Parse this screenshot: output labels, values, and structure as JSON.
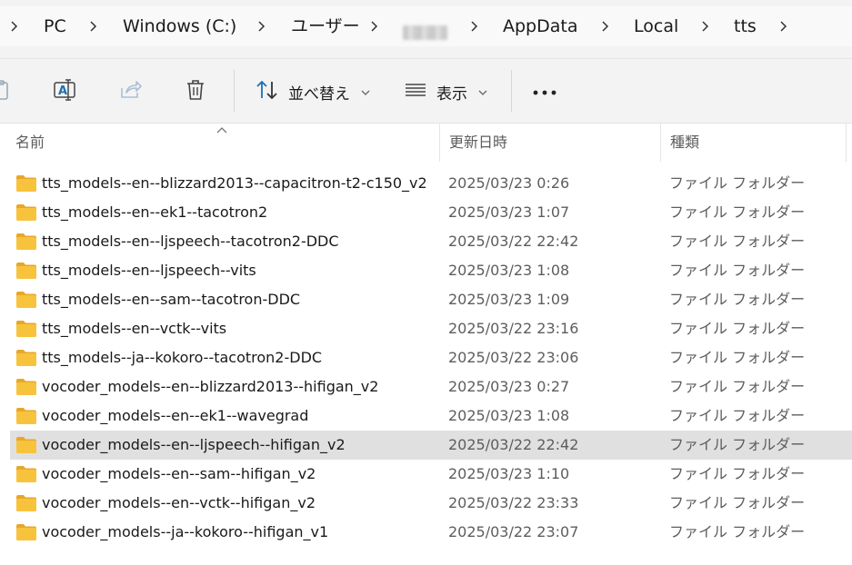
{
  "breadcrumb": {
    "items": [
      "PC",
      "Windows (C:)",
      "ユーザー",
      "AppData",
      "Local",
      "tts"
    ]
  },
  "toolbar": {
    "sort_label": "並べ替え",
    "view_label": "表示",
    "icons": [
      "paste-icon",
      "rename-icon",
      "share-icon",
      "delete-icon",
      "sort-icon",
      "view-icon",
      "more-icon"
    ]
  },
  "columns": {
    "name": "名前",
    "date": "更新日時",
    "type": "種類"
  },
  "files": [
    {
      "name": "tts_models--en--blizzard2013--capacitron-t2-c150_v2",
      "date": "2025/03/23 0:26",
      "type": "ファイル フォルダー"
    },
    {
      "name": "tts_models--en--ek1--tacotron2",
      "date": "2025/03/23 1:07",
      "type": "ファイル フォルダー"
    },
    {
      "name": "tts_models--en--ljspeech--tacotron2-DDC",
      "date": "2025/03/22 22:42",
      "type": "ファイル フォルダー"
    },
    {
      "name": "tts_models--en--ljspeech--vits",
      "date": "2025/03/23 1:08",
      "type": "ファイル フォルダー"
    },
    {
      "name": "tts_models--en--sam--tacotron-DDC",
      "date": "2025/03/23 1:09",
      "type": "ファイル フォルダー"
    },
    {
      "name": "tts_models--en--vctk--vits",
      "date": "2025/03/22 23:16",
      "type": "ファイル フォルダー"
    },
    {
      "name": "tts_models--ja--kokoro--tacotron2-DDC",
      "date": "2025/03/22 23:06",
      "type": "ファイル フォルダー"
    },
    {
      "name": "vocoder_models--en--blizzard2013--hifigan_v2",
      "date": "2025/03/23 0:27",
      "type": "ファイル フォルダー"
    },
    {
      "name": "vocoder_models--en--ek1--wavegrad",
      "date": "2025/03/23 1:08",
      "type": "ファイル フォルダー"
    },
    {
      "name": "vocoder_models--en--ljspeech--hifigan_v2",
      "date": "2025/03/22 22:42",
      "type": "ファイル フォルダー",
      "selected": true
    },
    {
      "name": "vocoder_models--en--sam--hifigan_v2",
      "date": "2025/03/23 1:10",
      "type": "ファイル フォルダー"
    },
    {
      "name": "vocoder_models--en--vctk--hifigan_v2",
      "date": "2025/03/22 23:33",
      "type": "ファイル フォルダー"
    },
    {
      "name": "vocoder_models--ja--kokoro--hifigan_v1",
      "date": "2025/03/22 23:07",
      "type": "ファイル フォルダー"
    }
  ],
  "colors": {
    "folder_fill": "#f8c33c",
    "folder_back": "#e8a72a",
    "selected_row": "#e0e0e0",
    "accent_icon": "#1f6fb5"
  }
}
